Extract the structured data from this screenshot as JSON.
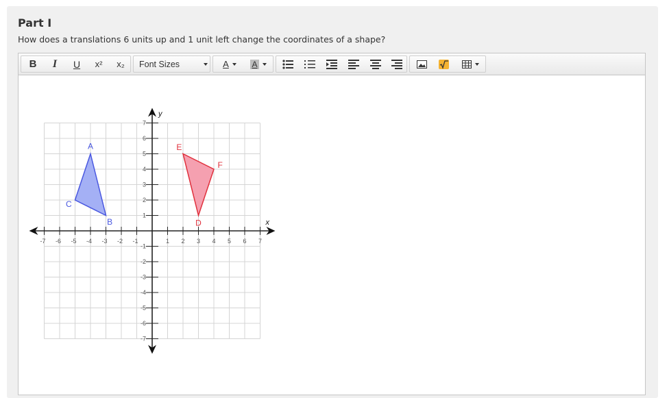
{
  "part_title": "Part I",
  "question": "How does a translations 6 units up and 1 unit left change the coordinates of a shape?",
  "toolbar": {
    "bold": "B",
    "italic": "I",
    "underline": "U",
    "superscript": "x²",
    "subscript": "x₂",
    "font_sizes": "Font Sizes",
    "font_color": "A",
    "highlight": "A"
  },
  "graph": {
    "x_axis_label": "x",
    "y_axis_label": "y",
    "x_range": [
      -7,
      7
    ],
    "y_range": [
      -7,
      7
    ],
    "x_ticks": [
      "-7",
      "-6",
      "-5",
      "-4",
      "-3",
      "-2",
      "-1",
      "1",
      "2",
      "3",
      "4",
      "5",
      "6",
      "7"
    ],
    "y_ticks": [
      "7",
      "6",
      "5",
      "4",
      "3",
      "2",
      "1",
      "-1",
      "-2",
      "-3",
      "-4",
      "-5",
      "-6",
      "-7"
    ],
    "shapes": [
      {
        "name": "triangle-ABC",
        "fill": "#a4b0f5",
        "stroke": "#4a58e0",
        "label_color": "#4a58e0",
        "vertices": [
          {
            "label": "A",
            "x": -4,
            "y": 5
          },
          {
            "label": "B",
            "x": -3,
            "y": 1
          },
          {
            "label": "C",
            "x": -5,
            "y": 2
          }
        ]
      },
      {
        "name": "triangle-DEF",
        "fill": "#f5a0b0",
        "stroke": "#e0303c",
        "label_color": "#e0303c",
        "vertices": [
          {
            "label": "E",
            "x": 2,
            "y": 5
          },
          {
            "label": "F",
            "x": 4,
            "y": 4
          },
          {
            "label": "D",
            "x": 3,
            "y": 1
          }
        ]
      }
    ]
  }
}
